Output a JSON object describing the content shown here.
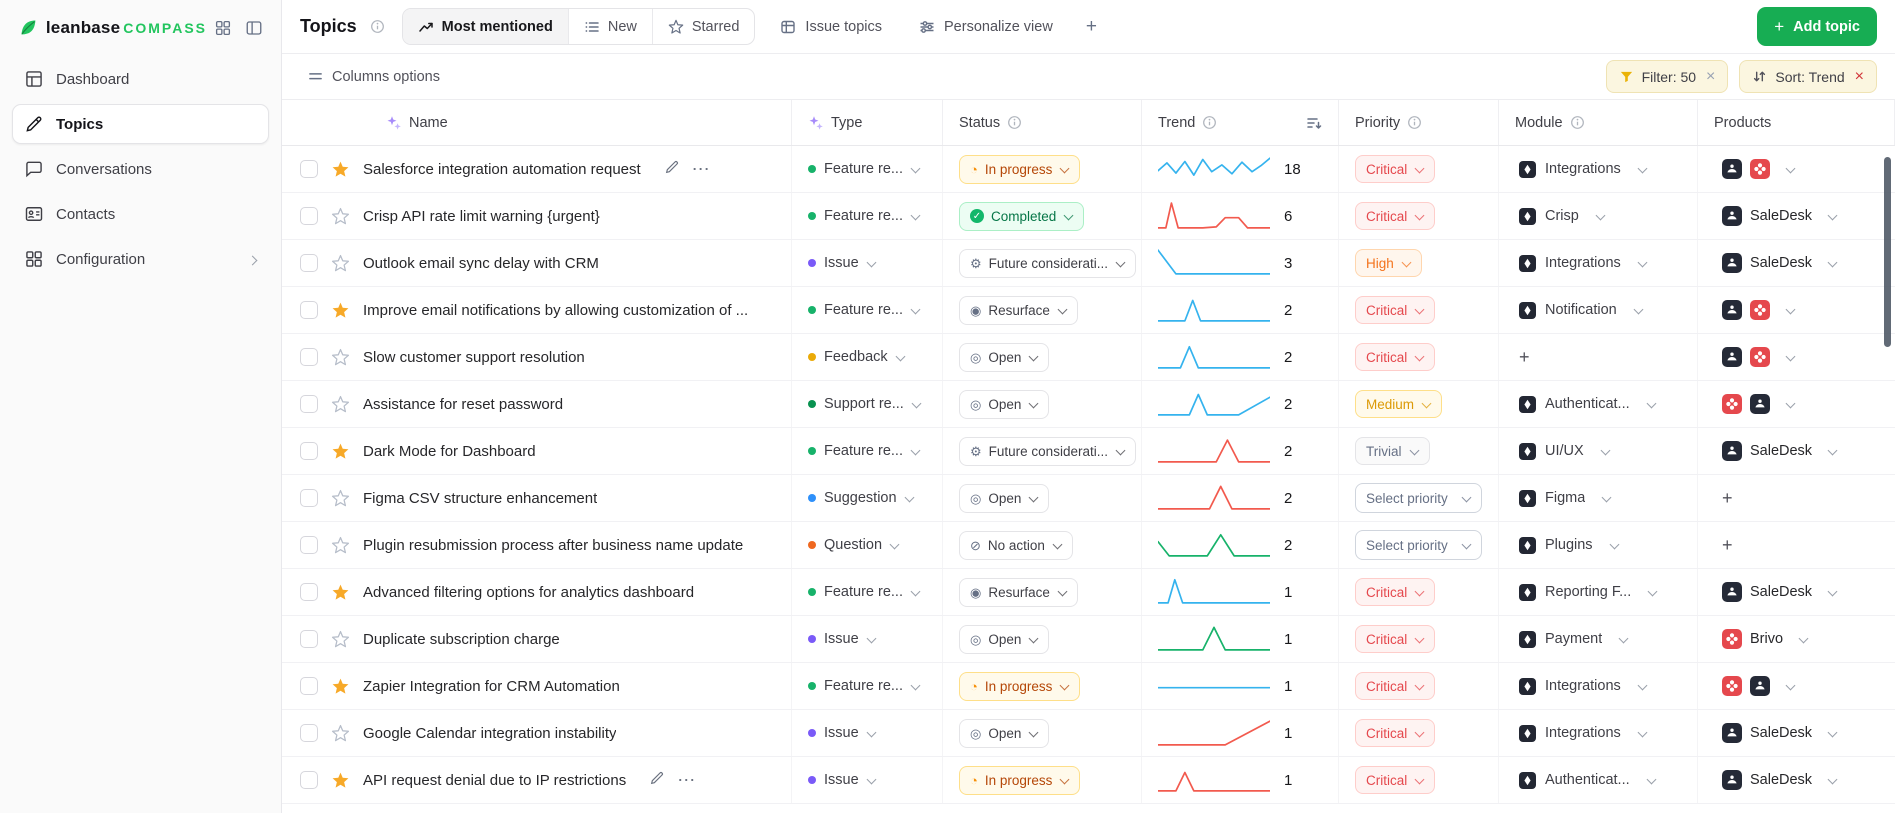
{
  "brand": {
    "left": "leanbase",
    "right": "COMPASS"
  },
  "sidebar": {
    "items": [
      {
        "label": "Dashboard",
        "active": false
      },
      {
        "label": "Topics",
        "active": true
      },
      {
        "label": "Conversations",
        "active": false
      },
      {
        "label": "Contacts",
        "active": false
      },
      {
        "label": "Configuration",
        "active": false,
        "has_chevron": true
      }
    ]
  },
  "header": {
    "title": "Topics",
    "tabs": [
      {
        "label": "Most mentioned",
        "active": true
      },
      {
        "label": "New",
        "active": false
      },
      {
        "label": "Starred",
        "active": false
      }
    ],
    "views": [
      {
        "label": "Issue topics"
      },
      {
        "label": "Personalize view"
      }
    ],
    "add_topic": "Add topic"
  },
  "toolbar": {
    "columns_options": "Columns options",
    "filter_chip": "Filter: 50",
    "sort_chip": "Sort: Trend"
  },
  "icons": {
    "add": "+",
    "close": "×",
    "ellipsis": "⋯"
  },
  "colors": {
    "accent_green": "#17ad53",
    "spark_blue": "#35b3ee",
    "spark_red": "#f25a4e",
    "spark_green": "#17b26a"
  },
  "table": {
    "columns": [
      "Name",
      "Type",
      "Status",
      "Trend",
      "Priority",
      "Module",
      "Products"
    ],
    "rows": [
      {
        "name": "Salesforce integration automation request",
        "starred": true,
        "actions": true,
        "type": {
          "label": "Feature re...",
          "color": "#17b26a"
        },
        "status": {
          "label": "In progress",
          "kind": "progress",
          "icon": "◔"
        },
        "trend": {
          "value": 18,
          "color": "#35b3ee",
          "points": [
            [
              0,
              55
            ],
            [
              8,
              32
            ],
            [
              16,
              62
            ],
            [
              24,
              28
            ],
            [
              32,
              68
            ],
            [
              40,
              22
            ],
            [
              48,
              58
            ],
            [
              57,
              38
            ],
            [
              66,
              64
            ],
            [
              75,
              30
            ],
            [
              84,
              58
            ],
            [
              92,
              40
            ],
            [
              100,
              18
            ]
          ]
        },
        "priority": {
          "label": "Critical",
          "kind": "critical"
        },
        "module": {
          "label": "Integrations"
        },
        "products": {
          "icons": [
            "saledesk",
            "brivo"
          ],
          "label": null
        }
      },
      {
        "name": "Crisp API rate limit warning {urgent}",
        "starred": false,
        "actions": false,
        "type": {
          "label": "Feature re...",
          "color": "#17b26a"
        },
        "status": {
          "label": "Completed",
          "kind": "completed",
          "icon": "✓"
        },
        "trend": {
          "value": 6,
          "color": "#f25a4e",
          "points": [
            [
              0,
              85
            ],
            [
              7,
              85
            ],
            [
              12,
              12
            ],
            [
              18,
              85
            ],
            [
              40,
              85
            ],
            [
              52,
              82
            ],
            [
              60,
              55
            ],
            [
              72,
              55
            ],
            [
              80,
              85
            ],
            [
              100,
              85
            ]
          ]
        },
        "priority": {
          "label": "Critical",
          "kind": "critical"
        },
        "module": {
          "label": "Crisp"
        },
        "products": {
          "icons": [
            "saledesk"
          ],
          "label": "SaleDesk"
        }
      },
      {
        "name": "Outlook email sync delay with CRM",
        "starred": false,
        "actions": false,
        "type": {
          "label": "Issue",
          "color": "#7a5af8"
        },
        "status": {
          "label": "Future considerati...",
          "kind": "neutral",
          "icon": "⚙"
        },
        "trend": {
          "value": 3,
          "color": "#35b3ee",
          "points": [
            [
              0,
              12
            ],
            [
              16,
              82
            ],
            [
              100,
              82
            ]
          ]
        },
        "priority": {
          "label": "High",
          "kind": "high"
        },
        "module": {
          "label": "Integrations"
        },
        "products": {
          "icons": [
            "saledesk"
          ],
          "label": "SaleDesk"
        }
      },
      {
        "name": "Improve email notifications by allowing customization of ...",
        "starred": true,
        "actions": false,
        "type": {
          "label": "Feature re...",
          "color": "#17b26a"
        },
        "status": {
          "label": "Resurface",
          "kind": "neutral",
          "icon": "◉"
        },
        "trend": {
          "value": 2,
          "color": "#35b3ee",
          "points": [
            [
              0,
              82
            ],
            [
              24,
              82
            ],
            [
              31,
              22
            ],
            [
              38,
              82
            ],
            [
              100,
              82
            ]
          ]
        },
        "priority": {
          "label": "Critical",
          "kind": "critical"
        },
        "module": {
          "label": "Notification"
        },
        "products": {
          "icons": [
            "saledesk",
            "brivo"
          ],
          "label": null
        }
      },
      {
        "name": "Slow customer support resolution",
        "starred": false,
        "actions": false,
        "type": {
          "label": "Feedback",
          "color": "#eaaa08"
        },
        "status": {
          "label": "Open",
          "kind": "neutral",
          "icon": "◎"
        },
        "trend": {
          "value": 2,
          "color": "#35b3ee",
          "points": [
            [
              0,
              82
            ],
            [
              20,
              82
            ],
            [
              28,
              20
            ],
            [
              36,
              82
            ],
            [
              100,
              82
            ]
          ]
        },
        "priority": {
          "label": "Critical",
          "kind": "critical"
        },
        "module": null,
        "products": {
          "icons": [
            "saledesk",
            "brivo"
          ],
          "label": null
        }
      },
      {
        "name": "Assistance for reset password",
        "starred": false,
        "actions": false,
        "type": {
          "label": "Support re...",
          "color": "#099250"
        },
        "status": {
          "label": "Open",
          "kind": "neutral",
          "icon": "◎"
        },
        "trend": {
          "value": 2,
          "color": "#35b3ee",
          "points": [
            [
              0,
              82
            ],
            [
              28,
              82
            ],
            [
              36,
              22
            ],
            [
              44,
              82
            ],
            [
              72,
              82
            ],
            [
              100,
              30
            ]
          ]
        },
        "priority": {
          "label": "Medium",
          "kind": "medium"
        },
        "module": {
          "label": "Authenticat..."
        },
        "products": {
          "icons": [
            "brivo",
            "saledesk"
          ],
          "label": null
        }
      },
      {
        "name": "Dark Mode for Dashboard",
        "starred": true,
        "actions": false,
        "type": {
          "label": "Feature re...",
          "color": "#17b26a"
        },
        "status": {
          "label": "Future considerati...",
          "kind": "neutral",
          "icon": "⚙"
        },
        "trend": {
          "value": 2,
          "color": "#f25a4e",
          "points": [
            [
              0,
              82
            ],
            [
              52,
              82
            ],
            [
              62,
              18
            ],
            [
              72,
              82
            ],
            [
              100,
              82
            ]
          ]
        },
        "priority": {
          "label": "Trivial",
          "kind": "trivial"
        },
        "module": {
          "label": "UI/UX"
        },
        "products": {
          "icons": [
            "saledesk"
          ],
          "label": "SaleDesk"
        }
      },
      {
        "name": "Figma CSV structure enhancement",
        "starred": false,
        "actions": false,
        "type": {
          "label": "Suggestion",
          "color": "#2e90fa"
        },
        "status": {
          "label": "Open",
          "kind": "neutral",
          "icon": "◎"
        },
        "trend": {
          "value": 2,
          "color": "#f25a4e",
          "points": [
            [
              0,
              82
            ],
            [
              46,
              82
            ],
            [
              56,
              16
            ],
            [
              66,
              82
            ],
            [
              100,
              82
            ]
          ]
        },
        "priority": {
          "label": "Select priority",
          "kind": "select"
        },
        "module": {
          "label": "Figma"
        },
        "products": null
      },
      {
        "name": "Plugin resubmission process after business name update",
        "starred": false,
        "actions": false,
        "type": {
          "label": "Question",
          "color": "#ef6820"
        },
        "status": {
          "label": "No action",
          "kind": "neutral",
          "icon": "⊘"
        },
        "trend": {
          "value": 2,
          "color": "#17b26a",
          "points": [
            [
              0,
              40
            ],
            [
              10,
              82
            ],
            [
              44,
              82
            ],
            [
              56,
              20
            ],
            [
              68,
              82
            ],
            [
              100,
              82
            ]
          ]
        },
        "priority": {
          "label": "Select priority",
          "kind": "select"
        },
        "module": {
          "label": "Plugins"
        },
        "products": null
      },
      {
        "name": "Advanced filtering options for analytics dashboard",
        "starred": true,
        "actions": false,
        "type": {
          "label": "Feature re...",
          "color": "#17b26a"
        },
        "status": {
          "label": "Resurface",
          "kind": "neutral",
          "icon": "◉"
        },
        "trend": {
          "value": 1,
          "color": "#35b3ee",
          "points": [
            [
              0,
              82
            ],
            [
              9,
              82
            ],
            [
              15,
              14
            ],
            [
              22,
              82
            ],
            [
              100,
              82
            ]
          ]
        },
        "priority": {
          "label": "Critical",
          "kind": "critical"
        },
        "module": {
          "label": "Reporting F..."
        },
        "products": {
          "icons": [
            "saledesk"
          ],
          "label": "SaleDesk"
        }
      },
      {
        "name": "Duplicate subscription charge",
        "starred": false,
        "actions": false,
        "type": {
          "label": "Issue",
          "color": "#7a5af8"
        },
        "status": {
          "label": "Open",
          "kind": "neutral",
          "icon": "◎"
        },
        "trend": {
          "value": 1,
          "color": "#17b26a",
          "points": [
            [
              0,
              82
            ],
            [
              40,
              82
            ],
            [
              50,
              16
            ],
            [
              60,
              82
            ],
            [
              100,
              82
            ]
          ]
        },
        "priority": {
          "label": "Critical",
          "kind": "critical"
        },
        "module": {
          "label": "Payment"
        },
        "products": {
          "icons": [
            "brivo"
          ],
          "label": "Brivo"
        }
      },
      {
        "name": "Zapier Integration for CRM Automation",
        "starred": true,
        "actions": false,
        "type": {
          "label": "Feature re...",
          "color": "#17b26a"
        },
        "status": {
          "label": "In progress",
          "kind": "progress",
          "icon": "◔"
        },
        "trend": {
          "value": 1,
          "color": "#35b3ee",
          "points": [
            [
              0,
              55
            ],
            [
              100,
              55
            ]
          ]
        },
        "priority": {
          "label": "Critical",
          "kind": "critical"
        },
        "module": {
          "label": "Integrations"
        },
        "products": {
          "icons": [
            "brivo",
            "saledesk"
          ],
          "label": null
        }
      },
      {
        "name": "Google Calendar integration instability",
        "starred": false,
        "actions": false,
        "type": {
          "label": "Issue",
          "color": "#7a5af8"
        },
        "status": {
          "label": "Open",
          "kind": "neutral",
          "icon": "◎"
        },
        "trend": {
          "value": 1,
          "color": "#f25a4e",
          "points": [
            [
              0,
              85
            ],
            [
              60,
              85
            ],
            [
              100,
              15
            ]
          ]
        },
        "priority": {
          "label": "Critical",
          "kind": "critical"
        },
        "module": {
          "label": "Integrations"
        },
        "products": {
          "icons": [
            "saledesk"
          ],
          "label": "SaleDesk"
        }
      },
      {
        "name": "API request denial due to IP restrictions",
        "starred": true,
        "actions": true,
        "type": {
          "label": "Issue",
          "color": "#7a5af8"
        },
        "status": {
          "label": "In progress",
          "kind": "progress",
          "icon": "◔"
        },
        "trend": {
          "value": 1,
          "color": "#f25a4e",
          "points": [
            [
              0,
              82
            ],
            [
              16,
              82
            ],
            [
              24,
              28
            ],
            [
              32,
              82
            ],
            [
              100,
              82
            ]
          ]
        },
        "priority": {
          "label": "Critical",
          "kind": "critical"
        },
        "module": {
          "label": "Authenticat..."
        },
        "products": {
          "icons": [
            "saledesk"
          ],
          "label": "SaleDesk"
        }
      }
    ]
  }
}
